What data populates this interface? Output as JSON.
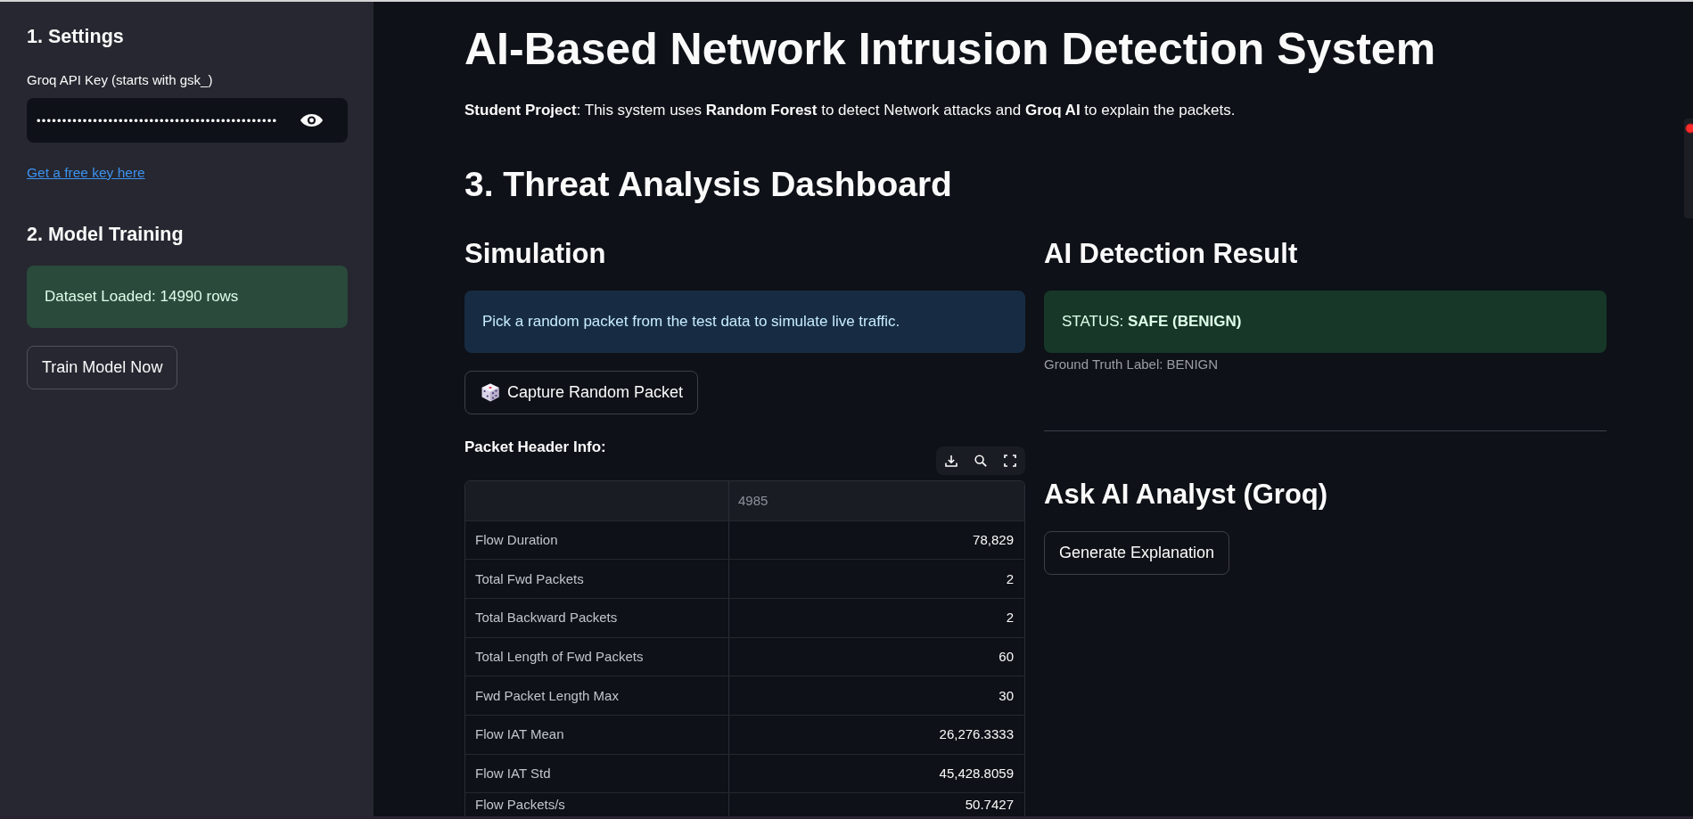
{
  "sidebar": {
    "settings_heading": "1. Settings",
    "api_key": {
      "label": "Groq API Key (starts with gsk_)",
      "value": "•••••••••••••••••••••••••••••••••••••••••••••••"
    },
    "key_link": "Get a free key here",
    "training_heading": "2. Model Training",
    "training_status": {
      "kind": "success",
      "text": "Dataset Loaded: 14990 rows"
    },
    "train_button": "Train Model Now"
  },
  "title": "AI-Based Network Intrusion Detection System",
  "intro": "**Student Project**: This system uses **Random Forest** to detect Network attacks and **Groq AI** to explain the packets.",
  "dashboard_heading": "3. Threat Analysis Dashboard",
  "simulation": {
    "heading": "Simulation",
    "message": {
      "kind": "info",
      "text": "Pick a random packet from the test data to simulate live traffic."
    },
    "capture_button": "Capture Random Packet",
    "table_title": "Packet Header Info:",
    "table": {
      "column_header": "4985",
      "rows": [
        {
          "label": "Flow Duration",
          "value": "78,829"
        },
        {
          "label": "Total Fwd Packets",
          "value": "2"
        },
        {
          "label": "Total Backward Packets",
          "value": "2"
        },
        {
          "label": "Total Length of Fwd Packets",
          "value": "60"
        },
        {
          "label": "Fwd Packet Length Max",
          "value": "30"
        },
        {
          "label": "Flow IAT Mean",
          "value": "26,276.3333"
        },
        {
          "label": "Flow IAT Std",
          "value": "45,428.8059"
        },
        {
          "label": "Flow Packets/s",
          "value": "50.7427"
        }
      ]
    }
  },
  "detection": {
    "heading": "AI Detection Result",
    "status": {
      "kind": "success",
      "text": "STATUS: **SAFE (BENIGN)**"
    },
    "ground_truth": "Ground Truth Label: BENIGN"
  },
  "analyst": {
    "heading": "Ask AI Analyst (Groq)",
    "button": "Generate Explanation"
  }
}
